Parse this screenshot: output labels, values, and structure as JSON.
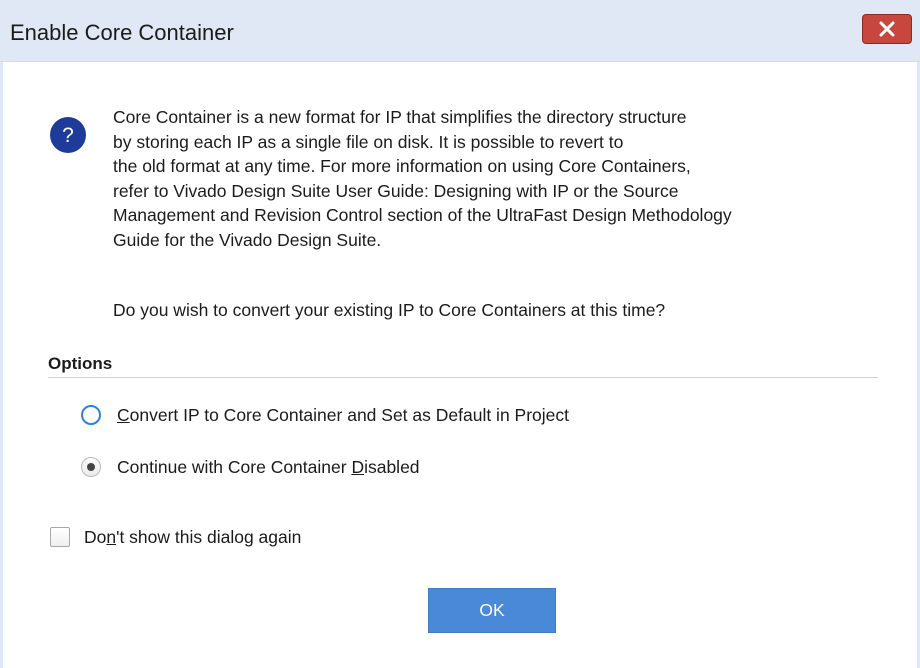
{
  "window": {
    "title": "Enable Core Container"
  },
  "message": {
    "lines": [
      "Core Container is a new format for IP that simplifies the directory structure",
      "by storing each IP as a single file on disk. It is possible to revert to",
      "the old format at any time. For more information on using Core Containers,",
      "refer to Vivado Design Suite User Guide: Designing with IP or the Source",
      "Management and Revision Control section of the UltraFast Design Methodology",
      "Guide for the Vivado Design Suite."
    ],
    "question": "Do you wish to convert your existing IP to Core Containers at this time?"
  },
  "options": {
    "title": "Options",
    "convert": {
      "mnemonic": "C",
      "rest": "onvert IP to Core Container and Set as Default in Project",
      "selected": false
    },
    "continue": {
      "before": "Continue with Core Container ",
      "mnemonic": "D",
      "after": "isabled",
      "selected": true
    }
  },
  "checkbox": {
    "before": "Do",
    "mnemonic": "n",
    "after": "'t show this dialog again",
    "checked": false
  },
  "buttons": {
    "ok": "OK"
  },
  "icons": {
    "question": "?",
    "close": "close-icon"
  },
  "colors": {
    "titlebar": "#dfe8f4",
    "close_button": "#c7463e",
    "accent_blue": "#4a89d8",
    "question_icon": "#1f3b99",
    "radio_focus": "#2d84d8"
  }
}
